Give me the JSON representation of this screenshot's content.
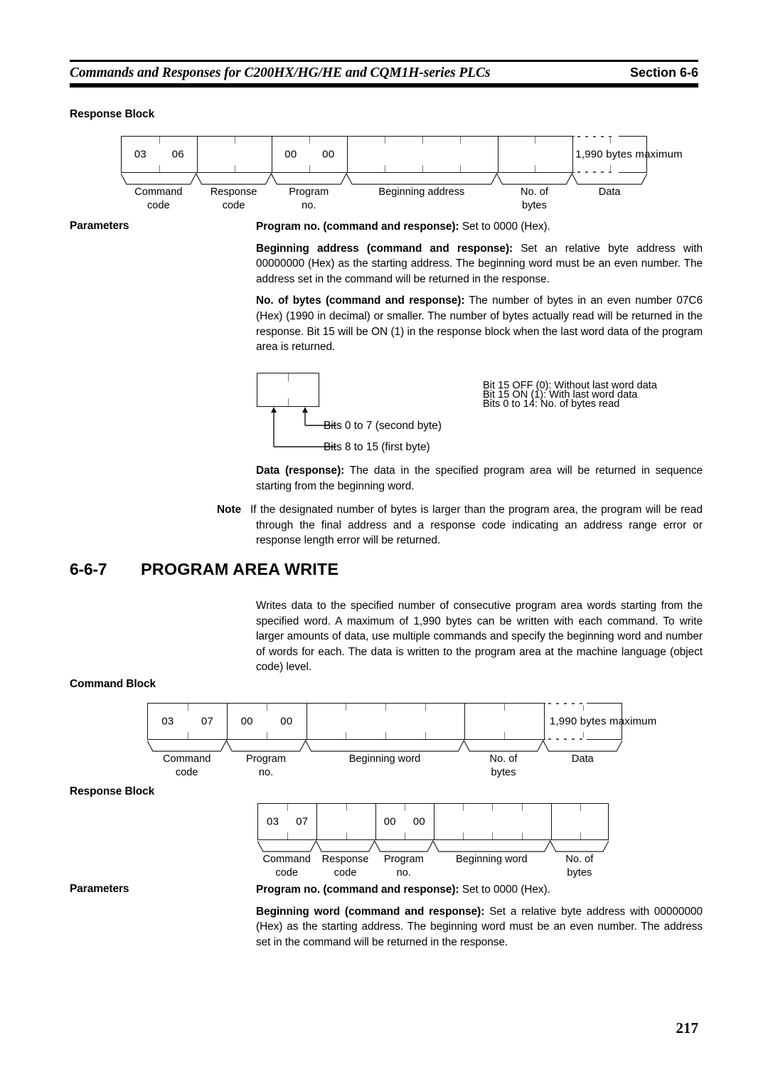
{
  "header": {
    "title": "Commands and Responses for C200HX/HG/HE and CQM1H-series PLCs",
    "section": "Section  6-6"
  },
  "block1": {
    "heading": "Response Block",
    "cells": [
      {
        "text": "03"
      },
      {
        "text": "06"
      },
      {
        "text": ""
      },
      {
        "text": ""
      },
      {
        "text": "00"
      },
      {
        "text": "00"
      },
      {
        "text": ""
      },
      {
        "text": ""
      },
      {
        "text": ""
      },
      {
        "text": ""
      },
      {
        "text": ""
      },
      {
        "text": ""
      },
      {
        "text": ""
      },
      {
        "text": "1,990 bytes maximum"
      }
    ],
    "labels": [
      "Command\ncode",
      "Response\ncode",
      "Program\nno.",
      "Beginning address",
      "No. of\nbytes",
      "Data"
    ],
    "data_note": "1,990 bytes maximum"
  },
  "params1": {
    "label": "Parameters",
    "entries": [
      {
        "bold": "Program no. (command and response):",
        "text": " Set to 0000 (Hex)."
      },
      {
        "bold": "Beginning address (command and response):",
        "text": " Set an relative byte address with 00000000 (Hex) as the starting address. The beginning word must be an even number. The address set in the command will be returned in the response."
      },
      {
        "bold": "No. of bytes (command and response):",
        "text": " The number of bytes in an even number 07C6 (Hex) (1990 in decimal) or smaller. The number of bytes actually read will be returned in the response. Bit 15 will be ON (1) in the response block when the last word data of the program area is returned."
      }
    ]
  },
  "bitdiag": {
    "notes": [
      "Bit 15 OFF (0): Without last word data",
      "Bit 15 ON (1): With last word data",
      "Bits 0 to 14: No. of bytes read"
    ],
    "leader_upper": "Bits 0 to 7 (second byte)",
    "leader_lower": "Bits 8 to 15 (first byte)"
  },
  "params1b": {
    "entries": [
      {
        "bold": "Data (response):",
        "text": " The data in the specified program area will be returned in sequence starting from the beginning word."
      }
    ]
  },
  "note": {
    "word": "Note",
    "text": "If the designated number of bytes is larger than the program area, the program will be read through the final address and a response code indicating an address range error or response length error will be returned."
  },
  "section": {
    "number": "6-6-7",
    "title": "PROGRAM AREA WRITE",
    "body": "Writes data to the specified number of consecutive program area words starting from the specified word. A maximum of 1,990 bytes can be written with each command. To write larger amounts of data, use multiple commands and specify the beginning word and number of words for each. The data is written to the program area at the machine language (object code) level."
  },
  "block2": {
    "heading": "Command Block",
    "cells": [
      {
        "text": "03"
      },
      {
        "text": "07"
      },
      {
        "text": "00"
      },
      {
        "text": "00"
      },
      {
        "text": ""
      },
      {
        "text": ""
      },
      {
        "text": ""
      },
      {
        "text": ""
      },
      {
        "text": ""
      },
      {
        "text": ""
      },
      {
        "text": ""
      },
      {
        "text": "1,990 bytes maximum"
      }
    ],
    "labels": [
      "Command\ncode",
      "Program\nno.",
      "Beginning word",
      "No. of\nbytes",
      "Data"
    ],
    "data_note": "1,990 bytes maximum"
  },
  "block3": {
    "heading": "Response Block",
    "cells": [
      {
        "text": "03"
      },
      {
        "text": "07"
      },
      {
        "text": ""
      },
      {
        "text": ""
      },
      {
        "text": "00"
      },
      {
        "text": "00"
      },
      {
        "text": ""
      },
      {
        "text": ""
      },
      {
        "text": ""
      },
      {
        "text": ""
      },
      {
        "text": ""
      },
      {
        "text": ""
      }
    ],
    "labels": [
      "Command\ncode",
      "Response\ncode",
      "Program\nno.",
      "Beginning word",
      "No. of\nbytes"
    ]
  },
  "params2": {
    "label": "Parameters",
    "entries": [
      {
        "bold": "Program no. (command and response):",
        "text": " Set to 0000 (Hex)."
      },
      {
        "bold": "Beginning word (command and response):",
        "text": " Set a relative byte address with 00000000 (Hex) as the starting address. The beginning word must be an even number. The address set in the command will be returned in the response."
      }
    ]
  },
  "page_number": "217"
}
